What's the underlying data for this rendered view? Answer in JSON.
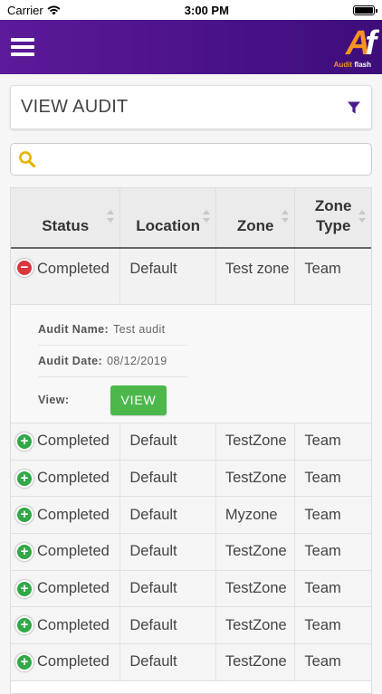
{
  "status_bar": {
    "carrier": "Carrier",
    "time": "3:00 PM"
  },
  "header": {
    "logo_mark_a": "A",
    "logo_mark_f": "f",
    "logo_text_1": "Audit",
    "logo_text_2": "flash"
  },
  "view_audit": {
    "title": "VIEW AUDIT"
  },
  "search": {
    "placeholder": "",
    "value": ""
  },
  "table": {
    "columns": [
      "Status",
      "Location",
      "Zone",
      "Zone Type"
    ],
    "expanded_row": {
      "status": "Completed",
      "location": "Default",
      "zone": "Test zone",
      "zone_type": "Team",
      "details": {
        "audit_name_label": "Audit Name:",
        "audit_name": "Test audit",
        "audit_date_label": "Audit Date:",
        "audit_date": "08/12/2019",
        "view_label": "View:",
        "view_button": "VIEW"
      }
    },
    "rows": [
      {
        "status": "Completed",
        "location": "Default",
        "zone": "TestZone",
        "zone_type": "Team"
      },
      {
        "status": "Completed",
        "location": "Default",
        "zone": "TestZone",
        "zone_type": "Team"
      },
      {
        "status": "Completed",
        "location": "Default",
        "zone": "Myzone",
        "zone_type": "Team"
      },
      {
        "status": "Completed",
        "location": "Default",
        "zone": "TestZone",
        "zone_type": "Team"
      },
      {
        "status": "Completed",
        "location": "Default",
        "zone": "TestZone",
        "zone_type": "Team"
      },
      {
        "status": "Completed",
        "location": "Default",
        "zone": "TestZone",
        "zone_type": "Team"
      },
      {
        "status": "Completed",
        "location": "Default",
        "zone": "TestZone",
        "zone_type": "Team"
      }
    ]
  },
  "colors": {
    "header_purple": "#4a1289",
    "accent_orange": "#f7931e",
    "plus_green": "#31a847",
    "minus_red": "#d9363e",
    "view_button_green": "#4cb84c"
  },
  "icons": {
    "menu": "hamburger-icon",
    "filter": "filter-icon",
    "search": "search-icon",
    "expand": "plus-circle-icon",
    "collapse": "minus-circle-icon"
  }
}
